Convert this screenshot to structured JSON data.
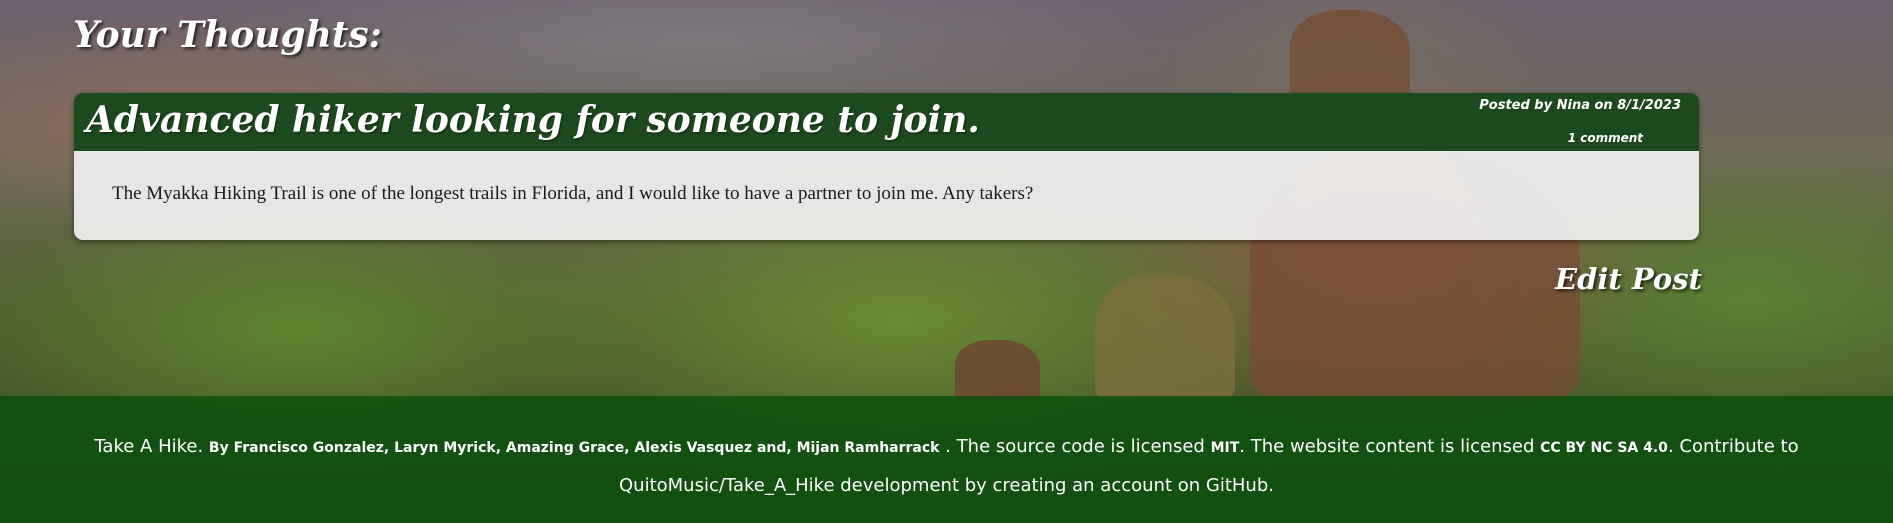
{
  "page": {
    "heading": "Your Thoughts:"
  },
  "post": {
    "title": "Advanced hiker looking for someone to join.",
    "byline": "Posted by Nina on 8/1/2023",
    "comments": "1 comment",
    "body": "The Myakka Hiking Trail is one of the longest trails in Florida, and I would like to have a partner to join me. Any takers?"
  },
  "actions": {
    "edit_post": "Edit Post"
  },
  "footer": {
    "site_name": "Take A Hike.",
    "authors": "By Francisco Gonzalez, Laryn Myrick, Amazing Grace, Alexis Vasquez and, Mijan Ramharrack",
    "code_text": ". The source code is licensed",
    "code_license": "MIT",
    "content_text": ". The website content is licensed",
    "content_license": "CC BY NC SA 4.0",
    "contribute_text": ". Contribute to QuitoMusic/Take_A_Hike development by creating an account on GitHub."
  }
}
